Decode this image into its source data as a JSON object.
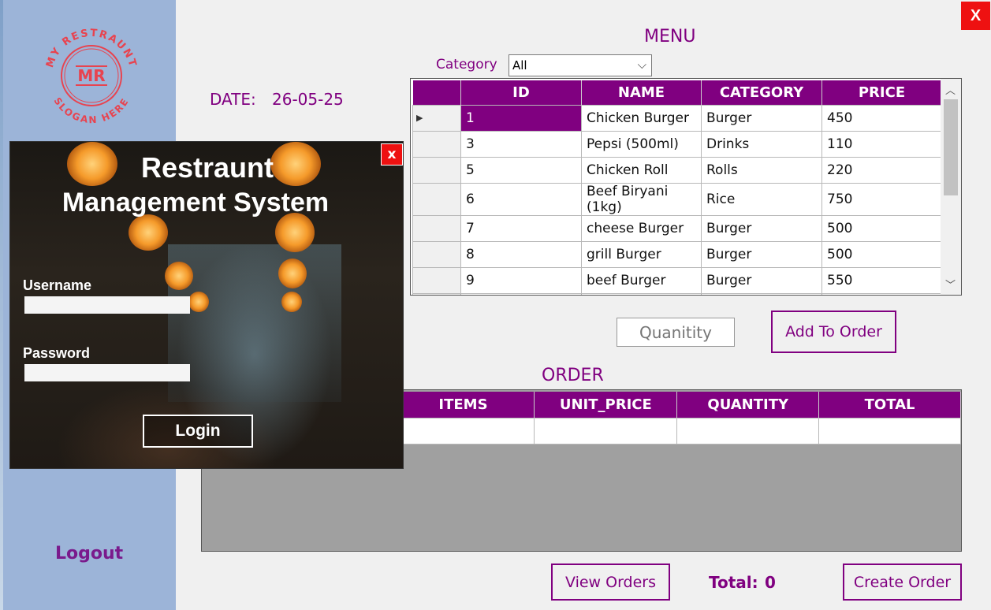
{
  "app": {
    "close_label": "X",
    "logo_text": "MR",
    "logo_top_text": "MY RESTRAUNT",
    "logo_bottom_text": "SLOGAN HERE",
    "logout_label": "Logout"
  },
  "header": {
    "date_label": "DATE:",
    "date_value": "26-05-25"
  },
  "menu": {
    "title": "MENU",
    "category_label": "Category",
    "category_selected": "All",
    "columns": [
      "ID",
      "NAME",
      "CATEGORY",
      "PRICE"
    ],
    "rows": [
      {
        "id": "1",
        "name": "Chicken Burger",
        "category": "Burger",
        "price": "450"
      },
      {
        "id": "3",
        "name": "Pepsi (500ml)",
        "category": "Drinks",
        "price": "110"
      },
      {
        "id": "5",
        "name": "Chicken Roll",
        "category": "Rolls",
        "price": "220"
      },
      {
        "id": "6",
        "name": "Beef Biryani (1kg)",
        "category": "Rice",
        "price": "750"
      },
      {
        "id": "7",
        "name": "cheese Burger",
        "category": "Burger",
        "price": "500"
      },
      {
        "id": "8",
        "name": "grill Burger",
        "category": "Burger",
        "price": "500"
      },
      {
        "id": "9",
        "name": "beef Burger",
        "category": "Burger",
        "price": "550"
      }
    ]
  },
  "actions": {
    "quantity_placeholder": "Quanitity",
    "add_to_order_label": "Add To Order"
  },
  "order": {
    "title": "ORDER",
    "columns": [
      "ITEMS",
      "UNIT_PRICE",
      "QUANTITY",
      "TOTAL"
    ],
    "view_orders_label": "View Orders",
    "total_label": "Total:",
    "total_value": "0",
    "create_order_label": "Create Order"
  },
  "login": {
    "title_line1": "Restraunt",
    "title_line2": "Management System",
    "close_label": "x",
    "username_label": "Username",
    "password_label": "Password",
    "login_label": "Login"
  },
  "colors": {
    "accent": "#800080",
    "sidebar": "#9cb4d8",
    "close": "#ee1111",
    "logo": "#e8434f"
  }
}
